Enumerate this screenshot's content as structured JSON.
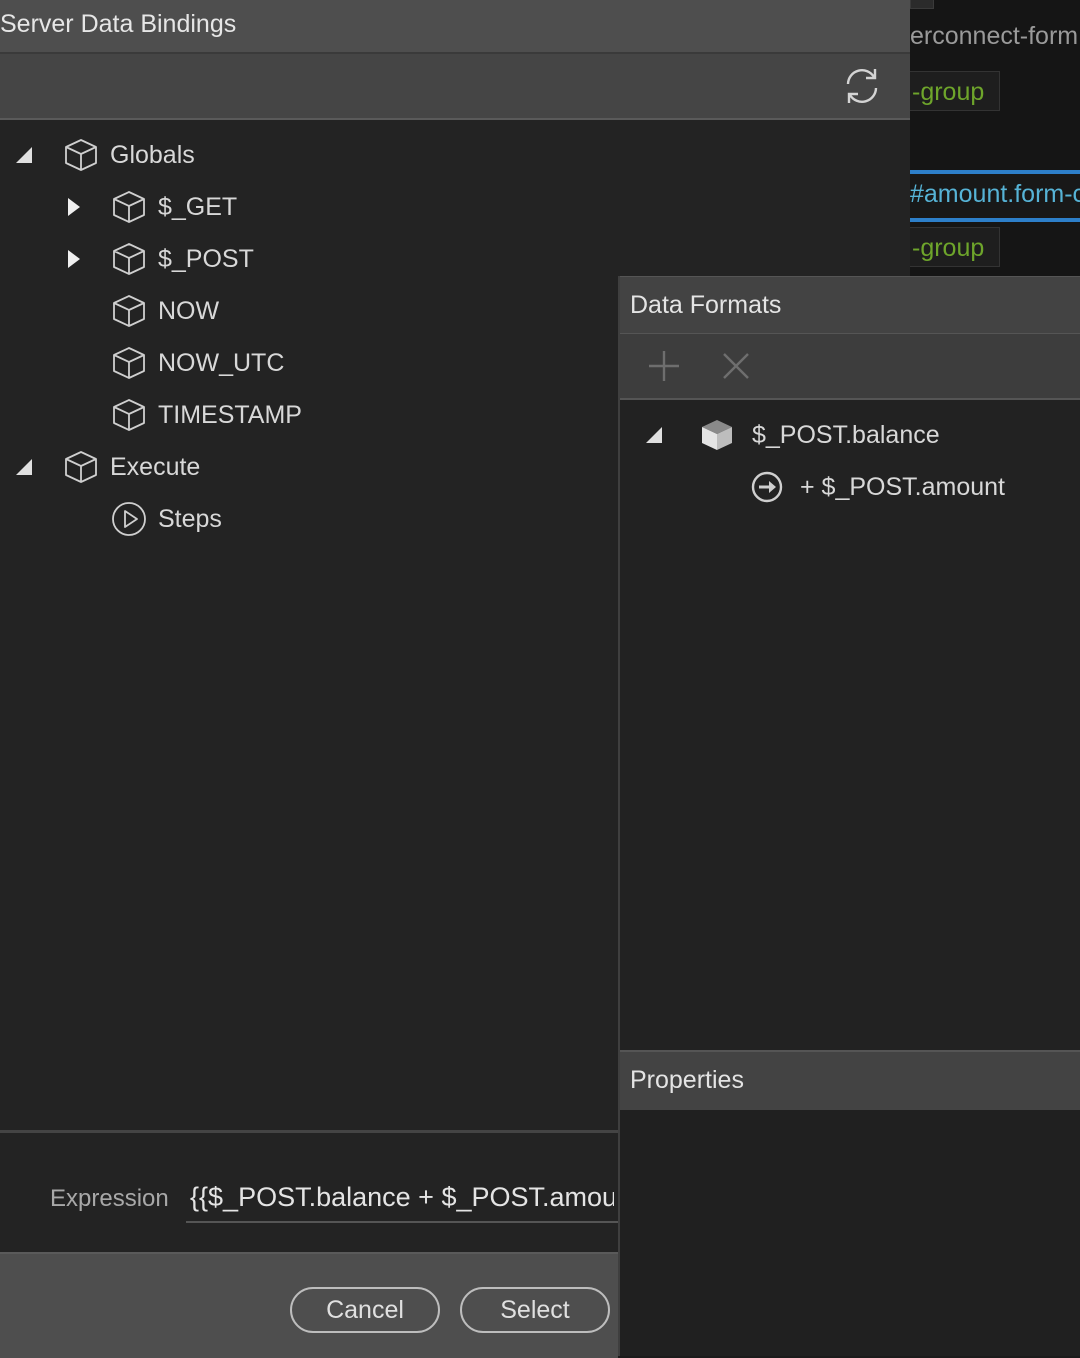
{
  "background_editor": {
    "line_grey": "erconnect-form",
    "chip1": "-group",
    "selected_line": "#amount.form-c",
    "chip2": "-group"
  },
  "dialog": {
    "title": "Server Data Bindings",
    "tree": [
      {
        "label": "Globals",
        "icon": "cube-outline-icon",
        "expander": "expanded"
      },
      {
        "label": "$_GET",
        "icon": "cube-outline-icon",
        "expander": "collapsed"
      },
      {
        "label": "$_POST",
        "icon": "cube-outline-icon",
        "expander": "collapsed"
      },
      {
        "label": "NOW",
        "icon": "cube-outline-icon",
        "expander": "none"
      },
      {
        "label": "NOW_UTC",
        "icon": "cube-outline-icon",
        "expander": "none"
      },
      {
        "label": "TIMESTAMP",
        "icon": "cube-outline-icon",
        "expander": "none"
      },
      {
        "label": "Execute",
        "icon": "cube-outline-icon",
        "expander": "expanded"
      },
      {
        "label": "Steps",
        "icon": "play-circle-icon",
        "expander": "none"
      }
    ],
    "expression": {
      "label": "Expression",
      "value": "{{$_POST.balance + $_POST.amount}}"
    },
    "buttons": {
      "cancel": "Cancel",
      "select": "Select"
    }
  },
  "data_formats": {
    "title": "Data Formats",
    "items": [
      {
        "label": "$_POST.balance",
        "icon": "cube-solid-icon",
        "expander": "expanded"
      },
      {
        "label": "+ $_POST.amount",
        "icon": "arrow-circle-icon",
        "expander": "none"
      }
    ]
  },
  "properties": {
    "title": "Properties"
  },
  "colors": {
    "accent_blue": "#2d7fc9",
    "code_green": "#6ea52b",
    "code_cyan": "#56b3d6"
  }
}
